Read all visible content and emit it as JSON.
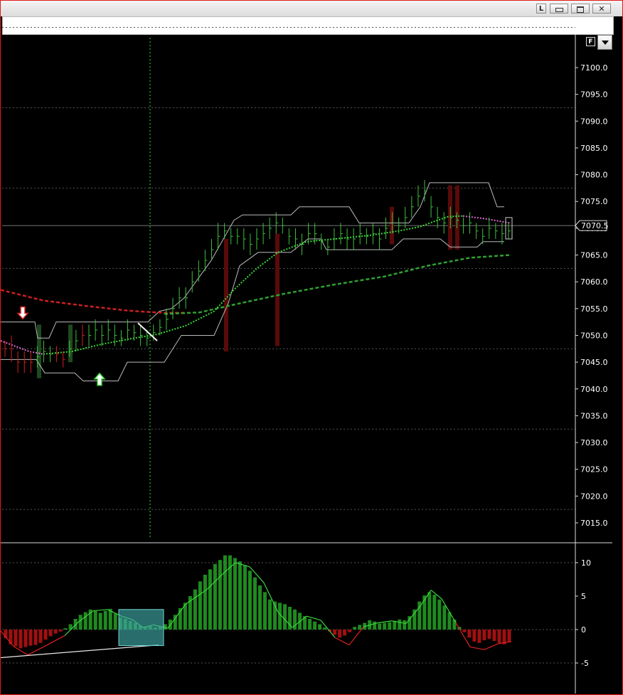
{
  "window": {
    "buttons": [
      "L",
      "",
      "",
      ""
    ]
  },
  "flag_label": "F",
  "price_axis": {
    "ticks": [
      "7100.0",
      "7095.0",
      "7090.0",
      "7085.0",
      "7080.0",
      "7075.0",
      "7070.0",
      "7065.0",
      "7060.0",
      "7055.0",
      "7050.0",
      "7045.0",
      "7040.0",
      "7035.0",
      "7030.0",
      "7025.0",
      "7020.0",
      "7015.0"
    ],
    "current_price_label": "7070.5"
  },
  "osc_axis": {
    "ticks": [
      "10",
      "5",
      "0",
      "-5"
    ]
  },
  "colors": {
    "background": "#000000",
    "bar_up": "#3fbf3f",
    "bar_down": "#d42020",
    "slow_ma": "#cc1f1f",
    "long_ma": "#2fa02f",
    "short_ma": "#3ad63a",
    "channel": "#bbbbbb",
    "osc_pos": "#1f8a1f",
    "osc_neg": "#a01010",
    "highlight": "#3fa8a8"
  },
  "chart_data": [
    {
      "type": "line",
      "ylim": [
        7012,
        7107
      ],
      "bars": [
        [
          7049,
          7046,
          "d"
        ],
        [
          7050,
          7045,
          "d"
        ],
        [
          7047,
          7043,
          "d"
        ],
        [
          7047,
          7043,
          "d"
        ],
        [
          7047,
          7043,
          "d"
        ],
        [
          7048,
          7044,
          "u"
        ],
        [
          7049,
          7045,
          "u"
        ],
        [
          7048,
          7045,
          "u"
        ],
        [
          7048,
          7045,
          "d"
        ],
        [
          7047,
          7044,
          "d"
        ],
        [
          7049,
          7046,
          "u"
        ],
        [
          7051,
          7047,
          "u"
        ],
        [
          7052,
          7048,
          "d"
        ],
        [
          7052,
          7048,
          "u"
        ],
        [
          7053,
          7049,
          "u"
        ],
        [
          7052,
          7048,
          "u"
        ],
        [
          7053,
          7049,
          "u"
        ],
        [
          7052,
          7048,
          "u"
        ],
        [
          7051,
          7048,
          "u"
        ],
        [
          7053,
          7049,
          "u"
        ],
        [
          7052,
          7049,
          "u"
        ],
        [
          7052,
          7048,
          "u"
        ],
        [
          7051,
          7048,
          "u"
        ],
        [
          7052,
          7049,
          "u"
        ],
        [
          7053,
          7050,
          "u"
        ],
        [
          7055,
          7051,
          "u"
        ],
        [
          7057,
          7053,
          "u"
        ],
        [
          7059,
          7055,
          "u"
        ],
        [
          7059,
          7055,
          "u"
        ],
        [
          7062,
          7058,
          "u"
        ],
        [
          7064,
          7060,
          "u"
        ],
        [
          7066,
          7062,
          "u"
        ],
        [
          7068,
          7064,
          "u"
        ],
        [
          7071,
          7066,
          "u"
        ],
        [
          7071,
          7068,
          "u"
        ],
        [
          7070,
          7067,
          "u"
        ],
        [
          7070,
          7067,
          "u"
        ],
        [
          7070,
          7066,
          "u"
        ],
        [
          7069,
          7065,
          "u"
        ],
        [
          7070,
          7066,
          "u"
        ],
        [
          7071,
          7067,
          "u"
        ],
        [
          7072,
          7068,
          "u"
        ],
        [
          7073,
          7069,
          "u"
        ],
        [
          7072,
          7069,
          "u"
        ],
        [
          7070,
          7067,
          "u"
        ],
        [
          7070,
          7066,
          "u"
        ],
        [
          7069,
          7065,
          "u"
        ],
        [
          7071,
          7067,
          "u"
        ],
        [
          7071,
          7067,
          "u"
        ],
        [
          7069,
          7066,
          "u"
        ],
        [
          7068,
          7065,
          "u"
        ],
        [
          7070,
          7066,
          "u"
        ],
        [
          7071,
          7067,
          "u"
        ],
        [
          7070,
          7066,
          "u"
        ],
        [
          7070,
          7066,
          "u"
        ],
        [
          7071,
          7067,
          "u"
        ],
        [
          7070,
          7067,
          "u"
        ],
        [
          7071,
          7067,
          "u"
        ],
        [
          7070,
          7066,
          "u"
        ],
        [
          7072,
          7068,
          "u"
        ],
        [
          7073,
          7069,
          "u"
        ],
        [
          7072,
          7069,
          "u"
        ],
        [
          7074,
          7070,
          "u"
        ],
        [
          7076,
          7072,
          "u"
        ],
        [
          7078,
          7074,
          "u"
        ],
        [
          7079,
          7075,
          "u"
        ],
        [
          7076,
          7072,
          "u"
        ],
        [
          7074,
          7070,
          "u"
        ],
        [
          7073,
          7069,
          "u"
        ],
        [
          7074,
          7070,
          "u"
        ],
        [
          7073,
          7070,
          "u"
        ],
        [
          7072,
          7069,
          "u"
        ],
        [
          7073,
          7069,
          "u"
        ],
        [
          7071,
          7068,
          "u"
        ],
        [
          7070,
          7067,
          "u"
        ],
        [
          7072,
          7068,
          "u"
        ],
        [
          7071,
          7068,
          "u"
        ],
        [
          7071,
          7067,
          "u"
        ],
        [
          7071,
          7068,
          "u"
        ]
      ],
      "channel_upper": [
        [
          0,
          7052.5
        ],
        [
          30,
          7052.5
        ],
        [
          48,
          7052.5
        ],
        [
          52,
          7049.5
        ],
        [
          68,
          7049.5
        ],
        [
          78,
          7052.5
        ],
        [
          185,
          7052.5
        ],
        [
          207,
          7052.5
        ],
        [
          223,
          7054.5
        ],
        [
          240,
          7055
        ],
        [
          258,
          7057
        ],
        [
          296,
          7064
        ],
        [
          328,
          7071.5
        ],
        [
          340,
          7072.5
        ],
        [
          408,
          7072.5
        ],
        [
          420,
          7074
        ],
        [
          490,
          7074
        ],
        [
          504,
          7071
        ],
        [
          574,
          7071
        ],
        [
          590,
          7074
        ],
        [
          603,
          7078.5
        ],
        [
          686,
          7078.5
        ],
        [
          698,
          7074
        ],
        [
          708,
          7074
        ]
      ],
      "channel_lower": [
        [
          0,
          7045.5
        ],
        [
          50,
          7045.5
        ],
        [
          62,
          7043
        ],
        [
          104,
          7043
        ],
        [
          116,
          7041.5
        ],
        [
          165,
          7041.5
        ],
        [
          178,
          7045
        ],
        [
          230,
          7045
        ],
        [
          254,
          7050
        ],
        [
          300,
          7050
        ],
        [
          320,
          7056
        ],
        [
          336,
          7063
        ],
        [
          362,
          7065.5
        ],
        [
          408,
          7065.5
        ],
        [
          432,
          7068
        ],
        [
          450,
          7068
        ],
        [
          458,
          7066
        ],
        [
          550,
          7066
        ],
        [
          566,
          7068
        ],
        [
          618,
          7068
        ],
        [
          632,
          7066.5
        ],
        [
          670,
          7066.5
        ],
        [
          678,
          7067.5
        ],
        [
          708,
          7067.5
        ]
      ],
      "slow_ma": [
        [
          0,
          7058.5
        ],
        [
          60,
          7056.5
        ],
        [
          120,
          7055.5
        ],
        [
          180,
          7054.6
        ],
        [
          230,
          7054.2
        ],
        [
          260,
          7054.2
        ]
      ],
      "long_ma": [
        [
          230,
          7054
        ],
        [
          280,
          7054.3
        ],
        [
          330,
          7055.8
        ],
        [
          400,
          7057.8
        ],
        [
          470,
          7059.5
        ],
        [
          540,
          7061
        ],
        [
          600,
          7063
        ],
        [
          660,
          7064.5
        ],
        [
          716,
          7065
        ]
      ],
      "short_ma": [
        [
          60,
          7046.5
        ],
        [
          100,
          7047
        ],
        [
          140,
          7048.3
        ],
        [
          180,
          7049.3
        ],
        [
          220,
          7050.2
        ],
        [
          260,
          7051.8
        ],
        [
          300,
          7054.5
        ],
        [
          330,
          7058.8
        ],
        [
          360,
          7062.5
        ],
        [
          390,
          7065.5
        ],
        [
          430,
          7067.5
        ],
        [
          470,
          7068
        ],
        [
          520,
          7068.7
        ],
        [
          560,
          7069.5
        ],
        [
          590,
          7070.3
        ],
        [
          610,
          7071.3
        ],
        [
          630,
          7072.2
        ],
        [
          650,
          7072.3
        ]
      ],
      "short_ma_pink": [
        [
          0,
          7049
        ],
        [
          40,
          7047
        ],
        [
          60,
          7046.5
        ]
      ],
      "short_ma_pink_end": [
        [
          650,
          7072.3
        ],
        [
          680,
          7071.8
        ],
        [
          716,
          7071
        ]
      ],
      "current_price": 7070.5,
      "signals": [
        {
          "type": "sell",
          "value": 7054
        },
        {
          "type": "buy",
          "value": 7042
        }
      ]
    },
    {
      "type": "bar",
      "ylim": [
        -9.2,
        12.5
      ],
      "histogram": [
        -1.3,
        -2.2,
        -2.5,
        -2.8,
        -2.6,
        -2.4,
        -2.3,
        -2.0,
        -1.5,
        -1.0,
        -0.6,
        -0.3,
        0.2,
        0.8,
        1.6,
        2.2,
        2.6,
        3.0,
        2.8,
        2.5,
        2.8,
        3.1,
        2.4,
        1.8,
        1.6,
        1.3,
        1.0,
        0.6,
        0.4,
        0.5,
        0.3,
        0.5,
        0.8,
        1.5,
        2.2,
        3.2,
        4.0,
        5.0,
        6.0,
        7.2,
        8.2,
        9.0,
        9.8,
        10.4,
        11.1,
        11.1,
        10.7,
        10.2,
        9.6,
        8.8,
        7.8,
        6.6,
        5.6,
        4.5,
        4.2,
        4.0,
        3.8,
        3.4,
        3.0,
        2.5,
        2.0,
        1.6,
        1.2,
        0.8,
        0.3,
        -0.3,
        -0.8,
        -1.2,
        -0.9,
        -0.4,
        0.4,
        0.7,
        1.0,
        1.4,
        1.2,
        0.9,
        1.0,
        1.1,
        1.3,
        1.5,
        1.4,
        2.0,
        3.0,
        4.2,
        5.1,
        5.6,
        5.2,
        4.5,
        3.6,
        2.6,
        1.5,
        0.4,
        -0.4,
        -1.2,
        -1.8,
        -2.0,
        -1.6,
        -1.4,
        -1.7,
        -2.0,
        -2.2,
        -1.8
      ],
      "signal_line": [
        [
          0,
          -0.2
        ],
        [
          18,
          -2.5
        ],
        [
          38,
          -3.8
        ],
        [
          60,
          -2.6
        ],
        [
          90,
          -0.9
        ],
        [
          110,
          1.2
        ],
        [
          130,
          2.8
        ],
        [
          150,
          3.0
        ],
        [
          170,
          2.0
        ],
        [
          185,
          1.5
        ],
        [
          200,
          0.3
        ],
        [
          215,
          0.7
        ],
        [
          235,
          0.2
        ],
        [
          260,
          3.8
        ],
        [
          290,
          6.0
        ],
        [
          315,
          8.6
        ],
        [
          330,
          10.0
        ],
        [
          350,
          9.4
        ],
        [
          370,
          7.0
        ],
        [
          390,
          2.6
        ],
        [
          410,
          0.3
        ],
        [
          430,
          2.0
        ],
        [
          450,
          1.4
        ],
        [
          470,
          -1.2
        ],
        [
          490,
          -2.3
        ],
        [
          510,
          0.4
        ],
        [
          530,
          1.0
        ],
        [
          550,
          1.3
        ],
        [
          570,
          0.9
        ],
        [
          590,
          3.5
        ],
        [
          605,
          5.9
        ],
        [
          620,
          4.6
        ],
        [
          640,
          1.0
        ],
        [
          660,
          -2.6
        ],
        [
          680,
          -3.0
        ],
        [
          700,
          -2.1
        ],
        [
          718,
          -1.8
        ]
      ],
      "trend_line": [
        [
          0,
          -4.2
        ],
        [
          222,
          -2.3
        ]
      ]
    }
  ]
}
